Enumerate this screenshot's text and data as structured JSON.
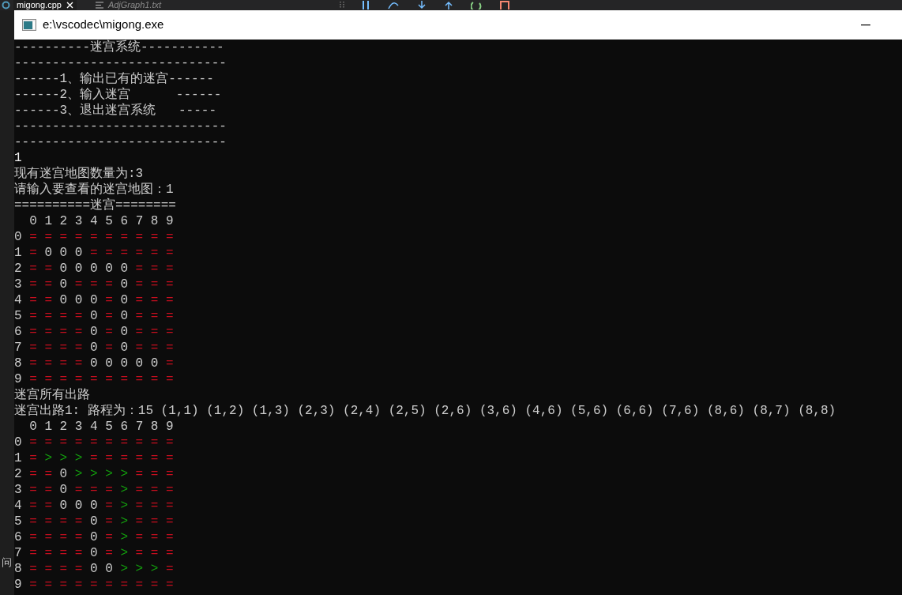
{
  "vscode": {
    "tabs": [
      {
        "label": "migong.cpp",
        "selected": true
      },
      {
        "label": "AdjGraph1.txt",
        "selected": false
      }
    ],
    "side_label": "问"
  },
  "window": {
    "title": "e:\\vscodec\\migong.exe"
  },
  "console": {
    "blocks": [
      {
        "kind": "text",
        "text": "----------迷宫系统-----------"
      },
      {
        "kind": "text",
        "text": "----------------------------"
      },
      {
        "kind": "text",
        "text": "------1、输出已有的迷宫------"
      },
      {
        "kind": "text",
        "text": "------2、输入迷宫      ------"
      },
      {
        "kind": "text",
        "text": "------3、退出迷宫系统   -----"
      },
      {
        "kind": "text",
        "text": "----------------------------"
      },
      {
        "kind": "text",
        "text": "----------------------------"
      },
      {
        "kind": "input",
        "text": "1"
      },
      {
        "kind": "text",
        "text": "现有迷宫地图数量为:3"
      },
      {
        "kind": "text",
        "text": "请输入要查看的迷宫地图：1"
      },
      {
        "kind": "text",
        "text": "==========迷宫========"
      },
      {
        "kind": "maze",
        "header": "  0 1 2 3 4 5 6 7 8 9",
        "rows": [
          {
            "label": "0",
            "cells": [
              {
                "text": "=",
                "kind": "wall"
              },
              {
                "text": "=",
                "kind": "wall"
              },
              {
                "text": "=",
                "kind": "wall"
              },
              {
                "text": "=",
                "kind": "wall"
              },
              {
                "text": "=",
                "kind": "wall"
              },
              {
                "text": "=",
                "kind": "wall"
              },
              {
                "text": "=",
                "kind": "wall"
              },
              {
                "text": "=",
                "kind": "wall"
              },
              {
                "text": "=",
                "kind": "wall"
              },
              {
                "text": "=",
                "kind": "wall"
              }
            ]
          },
          {
            "label": "1",
            "cells": [
              {
                "text": "=",
                "kind": "wall"
              },
              {
                "text": "0",
                "kind": "open"
              },
              {
                "text": "0",
                "kind": "open"
              },
              {
                "text": "0",
                "kind": "open"
              },
              {
                "text": "=",
                "kind": "wall"
              },
              {
                "text": "=",
                "kind": "wall"
              },
              {
                "text": "=",
                "kind": "wall"
              },
              {
                "text": "=",
                "kind": "wall"
              },
              {
                "text": "=",
                "kind": "wall"
              },
              {
                "text": "=",
                "kind": "wall"
              }
            ]
          },
          {
            "label": "2",
            "cells": [
              {
                "text": "=",
                "kind": "wall"
              },
              {
                "text": "=",
                "kind": "wall"
              },
              {
                "text": "0",
                "kind": "open"
              },
              {
                "text": "0",
                "kind": "open"
              },
              {
                "text": "0",
                "kind": "open"
              },
              {
                "text": "0",
                "kind": "open"
              },
              {
                "text": "0",
                "kind": "open"
              },
              {
                "text": "=",
                "kind": "wall"
              },
              {
                "text": "=",
                "kind": "wall"
              },
              {
                "text": "=",
                "kind": "wall"
              }
            ]
          },
          {
            "label": "3",
            "cells": [
              {
                "text": "=",
                "kind": "wall"
              },
              {
                "text": "=",
                "kind": "wall"
              },
              {
                "text": "0",
                "kind": "open"
              },
              {
                "text": "=",
                "kind": "wall"
              },
              {
                "text": "=",
                "kind": "wall"
              },
              {
                "text": "=",
                "kind": "wall"
              },
              {
                "text": "0",
                "kind": "open"
              },
              {
                "text": "=",
                "kind": "wall"
              },
              {
                "text": "=",
                "kind": "wall"
              },
              {
                "text": "=",
                "kind": "wall"
              }
            ]
          },
          {
            "label": "4",
            "cells": [
              {
                "text": "=",
                "kind": "wall"
              },
              {
                "text": "=",
                "kind": "wall"
              },
              {
                "text": "0",
                "kind": "open"
              },
              {
                "text": "0",
                "kind": "open"
              },
              {
                "text": "0",
                "kind": "open"
              },
              {
                "text": "=",
                "kind": "wall"
              },
              {
                "text": "0",
                "kind": "open"
              },
              {
                "text": "=",
                "kind": "wall"
              },
              {
                "text": "=",
                "kind": "wall"
              },
              {
                "text": "=",
                "kind": "wall"
              }
            ]
          },
          {
            "label": "5",
            "cells": [
              {
                "text": "=",
                "kind": "wall"
              },
              {
                "text": "=",
                "kind": "wall"
              },
              {
                "text": "=",
                "kind": "wall"
              },
              {
                "text": "=",
                "kind": "wall"
              },
              {
                "text": "0",
                "kind": "open"
              },
              {
                "text": "=",
                "kind": "wall"
              },
              {
                "text": "0",
                "kind": "open"
              },
              {
                "text": "=",
                "kind": "wall"
              },
              {
                "text": "=",
                "kind": "wall"
              },
              {
                "text": "=",
                "kind": "wall"
              }
            ]
          },
          {
            "label": "6",
            "cells": [
              {
                "text": "=",
                "kind": "wall"
              },
              {
                "text": "=",
                "kind": "wall"
              },
              {
                "text": "=",
                "kind": "wall"
              },
              {
                "text": "=",
                "kind": "wall"
              },
              {
                "text": "0",
                "kind": "open"
              },
              {
                "text": "=",
                "kind": "wall"
              },
              {
                "text": "0",
                "kind": "open"
              },
              {
                "text": "=",
                "kind": "wall"
              },
              {
                "text": "=",
                "kind": "wall"
              },
              {
                "text": "=",
                "kind": "wall"
              }
            ]
          },
          {
            "label": "7",
            "cells": [
              {
                "text": "=",
                "kind": "wall"
              },
              {
                "text": "=",
                "kind": "wall"
              },
              {
                "text": "=",
                "kind": "wall"
              },
              {
                "text": "=",
                "kind": "wall"
              },
              {
                "text": "0",
                "kind": "open"
              },
              {
                "text": "=",
                "kind": "wall"
              },
              {
                "text": "0",
                "kind": "open"
              },
              {
                "text": "=",
                "kind": "wall"
              },
              {
                "text": "=",
                "kind": "wall"
              },
              {
                "text": "=",
                "kind": "wall"
              }
            ]
          },
          {
            "label": "8",
            "cells": [
              {
                "text": "=",
                "kind": "wall"
              },
              {
                "text": "=",
                "kind": "wall"
              },
              {
                "text": "=",
                "kind": "wall"
              },
              {
                "text": "=",
                "kind": "wall"
              },
              {
                "text": "0",
                "kind": "open"
              },
              {
                "text": "0",
                "kind": "open"
              },
              {
                "text": "0",
                "kind": "open"
              },
              {
                "text": "0",
                "kind": "open"
              },
              {
                "text": "0",
                "kind": "open"
              },
              {
                "text": "=",
                "kind": "wall"
              }
            ]
          },
          {
            "label": "9",
            "cells": [
              {
                "text": "=",
                "kind": "wall"
              },
              {
                "text": "=",
                "kind": "wall"
              },
              {
                "text": "=",
                "kind": "wall"
              },
              {
                "text": "=",
                "kind": "wall"
              },
              {
                "text": "=",
                "kind": "wall"
              },
              {
                "text": "=",
                "kind": "wall"
              },
              {
                "text": "=",
                "kind": "wall"
              },
              {
                "text": "=",
                "kind": "wall"
              },
              {
                "text": "=",
                "kind": "wall"
              },
              {
                "text": "=",
                "kind": "wall"
              }
            ]
          }
        ]
      },
      {
        "kind": "text",
        "text": "迷宫所有出路"
      },
      {
        "kind": "text",
        "text": "迷宫出路1: 路程为：15 (1,1) (1,2) (1,3) (2,3) (2,4) (2,5) (2,6) (3,6) (4,6) (5,6) (6,6) (7,6) (8,6) (8,7) (8,8)"
      },
      {
        "kind": "maze",
        "header": "  0 1 2 3 4 5 6 7 8 9",
        "rows": [
          {
            "label": "0",
            "cells": [
              {
                "text": "=",
                "kind": "wall"
              },
              {
                "text": "=",
                "kind": "wall"
              },
              {
                "text": "=",
                "kind": "wall"
              },
              {
                "text": "=",
                "kind": "wall"
              },
              {
                "text": "=",
                "kind": "wall"
              },
              {
                "text": "=",
                "kind": "wall"
              },
              {
                "text": "=",
                "kind": "wall"
              },
              {
                "text": "=",
                "kind": "wall"
              },
              {
                "text": "=",
                "kind": "wall"
              },
              {
                "text": "=",
                "kind": "wall"
              }
            ]
          },
          {
            "label": "1",
            "cells": [
              {
                "text": "=",
                "kind": "wall"
              },
              {
                "text": ">",
                "kind": "path"
              },
              {
                "text": ">",
                "kind": "path"
              },
              {
                "text": ">",
                "kind": "path"
              },
              {
                "text": "=",
                "kind": "wall"
              },
              {
                "text": "=",
                "kind": "wall"
              },
              {
                "text": "=",
                "kind": "wall"
              },
              {
                "text": "=",
                "kind": "wall"
              },
              {
                "text": "=",
                "kind": "wall"
              },
              {
                "text": "=",
                "kind": "wall"
              }
            ]
          },
          {
            "label": "2",
            "cells": [
              {
                "text": "=",
                "kind": "wall"
              },
              {
                "text": "=",
                "kind": "wall"
              },
              {
                "text": "0",
                "kind": "open"
              },
              {
                "text": ">",
                "kind": "path"
              },
              {
                "text": ">",
                "kind": "path"
              },
              {
                "text": ">",
                "kind": "path"
              },
              {
                "text": ">",
                "kind": "path"
              },
              {
                "text": "=",
                "kind": "wall"
              },
              {
                "text": "=",
                "kind": "wall"
              },
              {
                "text": "=",
                "kind": "wall"
              }
            ]
          },
          {
            "label": "3",
            "cells": [
              {
                "text": "=",
                "kind": "wall"
              },
              {
                "text": "=",
                "kind": "wall"
              },
              {
                "text": "0",
                "kind": "open"
              },
              {
                "text": "=",
                "kind": "wall"
              },
              {
                "text": "=",
                "kind": "wall"
              },
              {
                "text": "=",
                "kind": "wall"
              },
              {
                "text": ">",
                "kind": "path"
              },
              {
                "text": "=",
                "kind": "wall"
              },
              {
                "text": "=",
                "kind": "wall"
              },
              {
                "text": "=",
                "kind": "wall"
              }
            ]
          },
          {
            "label": "4",
            "cells": [
              {
                "text": "=",
                "kind": "wall"
              },
              {
                "text": "=",
                "kind": "wall"
              },
              {
                "text": "0",
                "kind": "open"
              },
              {
                "text": "0",
                "kind": "open"
              },
              {
                "text": "0",
                "kind": "open"
              },
              {
                "text": "=",
                "kind": "wall"
              },
              {
                "text": ">",
                "kind": "path"
              },
              {
                "text": "=",
                "kind": "wall"
              },
              {
                "text": "=",
                "kind": "wall"
              },
              {
                "text": "=",
                "kind": "wall"
              }
            ]
          },
          {
            "label": "5",
            "cells": [
              {
                "text": "=",
                "kind": "wall"
              },
              {
                "text": "=",
                "kind": "wall"
              },
              {
                "text": "=",
                "kind": "wall"
              },
              {
                "text": "=",
                "kind": "wall"
              },
              {
                "text": "0",
                "kind": "open"
              },
              {
                "text": "=",
                "kind": "wall"
              },
              {
                "text": ">",
                "kind": "path"
              },
              {
                "text": "=",
                "kind": "wall"
              },
              {
                "text": "=",
                "kind": "wall"
              },
              {
                "text": "=",
                "kind": "wall"
              }
            ]
          },
          {
            "label": "6",
            "cells": [
              {
                "text": "=",
                "kind": "wall"
              },
              {
                "text": "=",
                "kind": "wall"
              },
              {
                "text": "=",
                "kind": "wall"
              },
              {
                "text": "=",
                "kind": "wall"
              },
              {
                "text": "0",
                "kind": "open"
              },
              {
                "text": "=",
                "kind": "wall"
              },
              {
                "text": ">",
                "kind": "path"
              },
              {
                "text": "=",
                "kind": "wall"
              },
              {
                "text": "=",
                "kind": "wall"
              },
              {
                "text": "=",
                "kind": "wall"
              }
            ]
          },
          {
            "label": "7",
            "cells": [
              {
                "text": "=",
                "kind": "wall"
              },
              {
                "text": "=",
                "kind": "wall"
              },
              {
                "text": "=",
                "kind": "wall"
              },
              {
                "text": "=",
                "kind": "wall"
              },
              {
                "text": "0",
                "kind": "open"
              },
              {
                "text": "=",
                "kind": "wall"
              },
              {
                "text": ">",
                "kind": "path"
              },
              {
                "text": "=",
                "kind": "wall"
              },
              {
                "text": "=",
                "kind": "wall"
              },
              {
                "text": "=",
                "kind": "wall"
              }
            ]
          },
          {
            "label": "8",
            "cells": [
              {
                "text": "=",
                "kind": "wall"
              },
              {
                "text": "=",
                "kind": "wall"
              },
              {
                "text": "=",
                "kind": "wall"
              },
              {
                "text": "=",
                "kind": "wall"
              },
              {
                "text": "0",
                "kind": "open"
              },
              {
                "text": "0",
                "kind": "open"
              },
              {
                "text": ">",
                "kind": "path"
              },
              {
                "text": ">",
                "kind": "path"
              },
              {
                "text": ">",
                "kind": "path"
              },
              {
                "text": "=",
                "kind": "wall"
              }
            ]
          },
          {
            "label": "9",
            "cells": [
              {
                "text": "=",
                "kind": "wall"
              },
              {
                "text": "=",
                "kind": "wall"
              },
              {
                "text": "=",
                "kind": "wall"
              },
              {
                "text": "=",
                "kind": "wall"
              },
              {
                "text": "=",
                "kind": "wall"
              },
              {
                "text": "=",
                "kind": "wall"
              },
              {
                "text": "=",
                "kind": "wall"
              },
              {
                "text": "=",
                "kind": "wall"
              },
              {
                "text": "=",
                "kind": "wall"
              },
              {
                "text": "=",
                "kind": "wall"
              }
            ]
          }
        ]
      }
    ]
  }
}
